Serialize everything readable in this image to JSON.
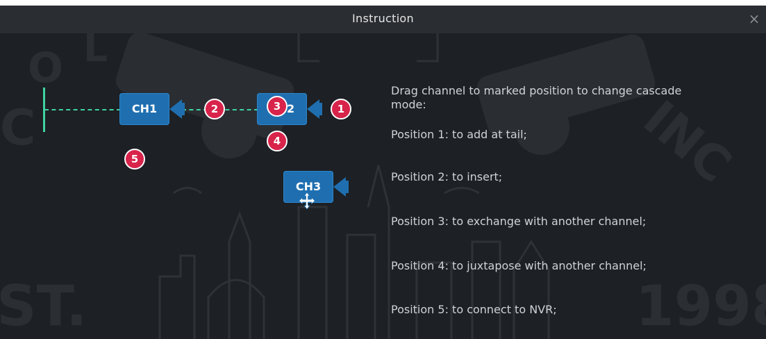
{
  "dialog": {
    "title": "Instruction",
    "close_glyph": "×"
  },
  "diagram": {
    "channels": [
      "CH1",
      "CH2",
      "CH3"
    ],
    "badges": [
      "1",
      "2",
      "3",
      "4",
      "5"
    ]
  },
  "instructions": {
    "heading_line1": "Drag channel to marked position to change cascade",
    "heading_line2": "mode:",
    "positions": [
      "Position 1: to add at tail;",
      "Position 2: to insert;",
      "Position 3: to exchange with another channel;",
      "Position 4: to juxtapose with another channel;",
      "Position 5:  to connect to NVR;"
    ]
  },
  "colors": {
    "background": "#1d2024",
    "camera": "#1f6fb0",
    "badge": "#d8234a",
    "link": "#3fd3a0"
  },
  "watermark": [
    "ST.",
    "1998",
    "C",
    "O",
    "L",
    "INC"
  ],
  "icons": [
    "close-icon",
    "camera-icon",
    "move-cursor-icon"
  ]
}
